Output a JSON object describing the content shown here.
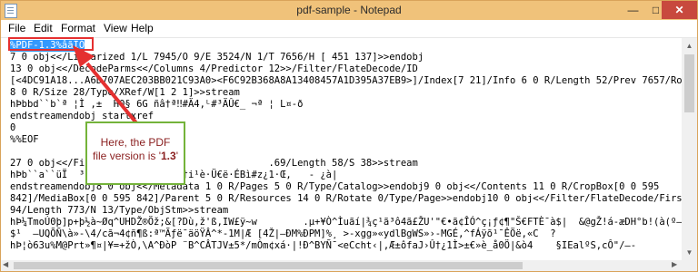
{
  "window": {
    "title": "pdf-sample - Notepad"
  },
  "controls": {
    "minimize": "—",
    "maximize": "□",
    "close": "✕"
  },
  "menu": [
    "File",
    "Edit",
    "Format",
    "View",
    "Help"
  ],
  "lines": [
    "%PDF-1.3%âãÏÓ",
    "7 0 obj<</Linearized 1/L 7945/O 9/E 3524/N 1/T 7656/H [ 451 137]>>endobj",
    "13 0 obj<</DecodeParms<</Columns 4/Predictor 12>>/Filter/FlateDecode/ID",
    "[<4DC91A18...A6D707AEC203BB021C93A0><F6C92B368A8A13408457A1D395A37EB9>]/Index[7 21]/Info 6 0 R/Length 52/Prev 7657/Root",
    "8 0 R/Size 28/Type/XRef/W[1 2 1]>>stream",
    "hÞbbd``b`ª ¦Ì ,±  H0§ 6G ñâ†ª‼#Ä4,ᴸ#³ÄÛ€_ ¬ª ¦ L¤-ð",
    "endstreamendobj startxref",
    "0",
    "%%EOF",
    "",
    "27 0 obj<</Fi...                             .69/Length 58/S 38>>stream",
    "hÞb``a``üÏ  ³ûÜ  ~      ÿÞÁè}Ä†i¹è·Ü€ë·ÉBì#z¿1·Œ,   - ¿à|",
    "endstreamendobj8 0 obj<</Metadata 1 0 R/Pages 5 0 R/Type/Catalog>>endobj9 0 obj<</Contents 11 0 R/CropBox[0 0 595",
    "842]/MediaBox[0 0 595 842]/Parent 5 0 R/Resources 14 0 R/Rotate 0/Type/Page>>endobj10 0 obj<</Filter/FlateDecode/First",
    "94/Length 773/N 13/Type/ObjStm>>stream",
    "hÞ¼TmoÚ0þ]p+þ½à~Øq^UHDŽ®Öž;&[?Dù,ž'ß,IW£ÿ~w        .µ+¥Ò^Ìuãí|¾ç¹ã³ô4ã£ŽU'\"€•ã¢ÎÓ^ç¡ƒ¢¶\"Š€FTÈ¯à$|  &@gŽ!á-æDH°b!(à(º—†£",
    "$¹  —UQÕÑ\\à»-\\4/cã¬4¢ñ¶ß:ª™Ãƒë¯äöŸÂ^*-1M|Æ [4Ž|–ÐM%ÐPM]%¸ >-xgg»«ydlBgWS»›-MGÉ,^fÁÿõ¹¯ÊÖë,«C  ?",
    "hÞ¦ò63u%M@Prt»¶¤|¥=+žÒ,\\A^ÐòP ¨B^CÂTJV±5*/mÒm¢xá·|!Ð^BYÑ¯<eCcht‹|,Æ±ôfaJ›Û†¿1Ì>±€»è_å0Ö|&ò4    §IEalºS,cÔ\"/—-"
  ],
  "callout": {
    "line1": "Here, the PDF",
    "line2_prefix": "file version is '",
    "version": "1.3",
    "line2_suffix": "'"
  },
  "colors": {
    "titlebar": "#f0c27a",
    "selection": "#3399ff",
    "highlight": "#e53030",
    "callout_border": "#74b33a",
    "callout_text": "#8a1f1f"
  }
}
